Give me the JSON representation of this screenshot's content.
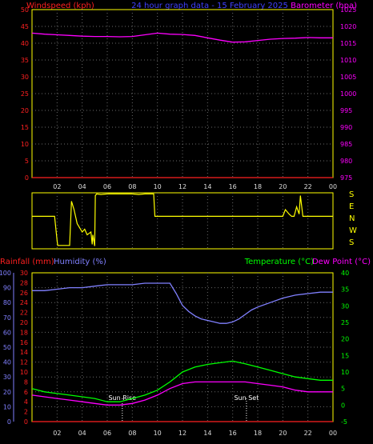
{
  "chart_data": [
    {
      "type": "line",
      "title": "24 hour graph data - 15 February 2025",
      "left_axis": {
        "label": "Windspeed (kph)",
        "range": [
          0,
          50
        ],
        "ticks": [
          0,
          5,
          10,
          15,
          20,
          25,
          30,
          35,
          40,
          45,
          50
        ],
        "color": "#ff2020"
      },
      "right_axis": {
        "label": "Barometer (hpa)",
        "range": [
          975,
          1025
        ],
        "ticks": [
          975,
          980,
          985,
          990,
          995,
          1000,
          1005,
          1010,
          1015,
          1020,
          1025
        ],
        "color": "#ff00ff"
      },
      "x_ticks": [
        "02",
        "04",
        "06",
        "08",
        "10",
        "12",
        "14",
        "16",
        "18",
        "20",
        "22",
        "00"
      ],
      "series": [
        {
          "name": "Barometer (hpa)",
          "axis": "right",
          "color": "#ff00ff",
          "x": [
            0,
            1,
            2,
            3,
            4,
            5,
            6,
            7,
            8,
            9,
            10,
            11,
            12,
            13,
            14,
            15,
            16,
            17,
            18,
            19,
            20,
            21,
            22,
            23,
            24
          ],
          "values": [
            1018,
            1017.7,
            1017.5,
            1017.3,
            1017.1,
            1017,
            1017,
            1016.9,
            1017,
            1017.5,
            1018,
            1017.7,
            1017.6,
            1017.3,
            1016.6,
            1015.9,
            1015.3,
            1015.4,
            1015.8,
            1016.2,
            1016.4,
            1016.5,
            1016.7,
            1016.6,
            1016.6
          ]
        },
        {
          "name": "Windspeed (kph)",
          "axis": "left",
          "color": "#ff2020",
          "x": [
            0,
            24
          ],
          "values": [
            0,
            0
          ]
        }
      ]
    },
    {
      "type": "line",
      "title": "",
      "directions": [
        "S",
        "E",
        "N",
        "W",
        "S"
      ],
      "x_ticks": [
        "02",
        "04",
        "06",
        "08",
        "10",
        "12",
        "14",
        "16",
        "18",
        "20",
        "22",
        "00"
      ],
      "series": [
        {
          "name": "",
          "color": "#ffff00",
          "x": [
            0,
            0.3,
            1.8,
            2.0,
            2.05,
            3.0,
            3.15,
            3.35,
            3.6,
            4.0,
            4.2,
            4.4,
            4.7,
            4.8,
            4.85,
            5.0,
            5.05,
            5.15,
            5.5,
            6.0,
            8.0,
            8.5,
            9.0,
            9.7,
            9.8,
            18.0,
            20.0,
            20.2,
            20.5,
            20.7,
            20.9,
            21.1,
            21.3,
            21.4,
            21.6,
            22.0,
            24.0
          ],
          "values": [
            0.58,
            0.58,
            0.58,
            0.15,
            0.06,
            0.06,
            0.85,
            0.7,
            0.45,
            0.3,
            0.35,
            0.25,
            0.3,
            0.08,
            0.25,
            0.05,
            0.95,
            0.98,
            0.97,
            0.98,
            0.98,
            0.97,
            0.98,
            0.98,
            0.58,
            0.58,
            0.58,
            0.7,
            0.62,
            0.58,
            0.58,
            0.75,
            0.62,
            0.95,
            0.58,
            0.58,
            0.58
          ]
        }
      ]
    },
    {
      "type": "line",
      "title": "",
      "axes": {
        "rainfall": {
          "label": "Rainfall (mm)",
          "range": [
            0,
            30
          ],
          "ticks": [
            0,
            2,
            4,
            6,
            8,
            10,
            12,
            14,
            16,
            18,
            20,
            22,
            24,
            26,
            28,
            30
          ],
          "color": "#ff2020"
        },
        "humidity": {
          "label": "Humidity (%)",
          "range": [
            0,
            100
          ],
          "ticks": [
            0,
            10,
            20,
            30,
            40,
            50,
            60,
            70,
            80,
            90,
            100
          ],
          "color": "#8080ff"
        },
        "temperature": {
          "label": "Temperature (°C)",
          "range": [
            -5,
            40
          ],
          "ticks": [
            -5,
            0,
            5,
            10,
            15,
            20,
            25,
            30,
            35,
            40
          ],
          "color": "#00ff00"
        },
        "dew_point": {
          "label": "Dew Point (°C)",
          "color": "#ff00ff"
        }
      },
      "x_ticks": [
        "02",
        "04",
        "06",
        "08",
        "10",
        "12",
        "14",
        "16",
        "18",
        "20",
        "22",
        "00"
      ],
      "annotations": {
        "sunrise": {
          "label": "Sun Rise",
          "x": 7.2
        },
        "sunset": {
          "label": "Sun Set",
          "x": 17.1
        }
      },
      "series": [
        {
          "name": "Humidity (%)",
          "axis": "humidity",
          "color": "#8080ff",
          "x": [
            0,
            1,
            2,
            3,
            4,
            5,
            6,
            7,
            8,
            9,
            10,
            11,
            11.5,
            12,
            12.5,
            13,
            13.5,
            14,
            14.5,
            15,
            15.5,
            16,
            16.5,
            17,
            17.5,
            18,
            19,
            20,
            21,
            22,
            23,
            24
          ],
          "values": [
            88,
            88,
            89,
            90,
            90,
            91,
            92,
            92,
            92,
            93,
            93,
            93,
            86,
            78,
            74,
            71,
            69,
            68,
            67,
            66,
            66,
            67,
            69,
            72,
            75,
            77,
            80,
            83,
            85,
            86,
            87,
            87
          ]
        },
        {
          "name": "Temperature (°C)",
          "axis": "temperature",
          "color": "#00ff00",
          "x": [
            0,
            1,
            2,
            3,
            4,
            5,
            6,
            7,
            8,
            9,
            10,
            11,
            12,
            13,
            14,
            15,
            16,
            17,
            18,
            19,
            20,
            21,
            22,
            23,
            24
          ],
          "values": [
            5,
            4,
            3.5,
            3,
            2.5,
            2,
            1,
            1,
            2,
            3,
            4.5,
            7,
            10,
            11.5,
            12.3,
            12.8,
            13.3,
            12.5,
            11.5,
            10.5,
            9.5,
            8.5,
            8,
            7.5,
            7.5
          ]
        },
        {
          "name": "Dew Point (°C)",
          "axis": "temperature",
          "color": "#ff00ff",
          "x": [
            0,
            1,
            2,
            3,
            4,
            5,
            6,
            7,
            8,
            9,
            10,
            11,
            12,
            13,
            14,
            15,
            16,
            17,
            18,
            19,
            20,
            21,
            22,
            23,
            24
          ],
          "values": [
            3,
            2.5,
            2,
            1.5,
            1,
            0.5,
            0,
            0,
            0.5,
            1.5,
            3,
            5,
            6.5,
            7,
            7,
            7,
            7,
            7,
            6.5,
            6,
            5.5,
            4.5,
            4,
            4,
            4
          ]
        },
        {
          "name": "Rainfall (mm)",
          "axis": "rainfall",
          "color": "#ff2020",
          "x": [
            0,
            24
          ],
          "values": [
            0,
            0
          ]
        }
      ]
    }
  ]
}
